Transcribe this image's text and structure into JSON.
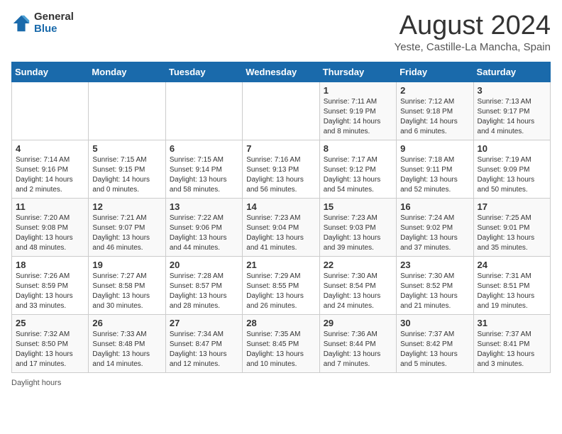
{
  "logo": {
    "general": "General",
    "blue": "Blue"
  },
  "title": "August 2024",
  "subtitle": "Yeste, Castille-La Mancha, Spain",
  "days_of_week": [
    "Sunday",
    "Monday",
    "Tuesday",
    "Wednesday",
    "Thursday",
    "Friday",
    "Saturday"
  ],
  "weeks": [
    [
      {
        "day": "",
        "info": ""
      },
      {
        "day": "",
        "info": ""
      },
      {
        "day": "",
        "info": ""
      },
      {
        "day": "",
        "info": ""
      },
      {
        "day": "1",
        "info": "Sunrise: 7:11 AM\nSunset: 9:19 PM\nDaylight: 14 hours\nand 8 minutes."
      },
      {
        "day": "2",
        "info": "Sunrise: 7:12 AM\nSunset: 9:18 PM\nDaylight: 14 hours\nand 6 minutes."
      },
      {
        "day": "3",
        "info": "Sunrise: 7:13 AM\nSunset: 9:17 PM\nDaylight: 14 hours\nand 4 minutes."
      }
    ],
    [
      {
        "day": "4",
        "info": "Sunrise: 7:14 AM\nSunset: 9:16 PM\nDaylight: 14 hours\nand 2 minutes."
      },
      {
        "day": "5",
        "info": "Sunrise: 7:15 AM\nSunset: 9:15 PM\nDaylight: 14 hours\nand 0 minutes."
      },
      {
        "day": "6",
        "info": "Sunrise: 7:15 AM\nSunset: 9:14 PM\nDaylight: 13 hours\nand 58 minutes."
      },
      {
        "day": "7",
        "info": "Sunrise: 7:16 AM\nSunset: 9:13 PM\nDaylight: 13 hours\nand 56 minutes."
      },
      {
        "day": "8",
        "info": "Sunrise: 7:17 AM\nSunset: 9:12 PM\nDaylight: 13 hours\nand 54 minutes."
      },
      {
        "day": "9",
        "info": "Sunrise: 7:18 AM\nSunset: 9:11 PM\nDaylight: 13 hours\nand 52 minutes."
      },
      {
        "day": "10",
        "info": "Sunrise: 7:19 AM\nSunset: 9:09 PM\nDaylight: 13 hours\nand 50 minutes."
      }
    ],
    [
      {
        "day": "11",
        "info": "Sunrise: 7:20 AM\nSunset: 9:08 PM\nDaylight: 13 hours\nand 48 minutes."
      },
      {
        "day": "12",
        "info": "Sunrise: 7:21 AM\nSunset: 9:07 PM\nDaylight: 13 hours\nand 46 minutes."
      },
      {
        "day": "13",
        "info": "Sunrise: 7:22 AM\nSunset: 9:06 PM\nDaylight: 13 hours\nand 44 minutes."
      },
      {
        "day": "14",
        "info": "Sunrise: 7:23 AM\nSunset: 9:04 PM\nDaylight: 13 hours\nand 41 minutes."
      },
      {
        "day": "15",
        "info": "Sunrise: 7:23 AM\nSunset: 9:03 PM\nDaylight: 13 hours\nand 39 minutes."
      },
      {
        "day": "16",
        "info": "Sunrise: 7:24 AM\nSunset: 9:02 PM\nDaylight: 13 hours\nand 37 minutes."
      },
      {
        "day": "17",
        "info": "Sunrise: 7:25 AM\nSunset: 9:01 PM\nDaylight: 13 hours\nand 35 minutes."
      }
    ],
    [
      {
        "day": "18",
        "info": "Sunrise: 7:26 AM\nSunset: 8:59 PM\nDaylight: 13 hours\nand 33 minutes."
      },
      {
        "day": "19",
        "info": "Sunrise: 7:27 AM\nSunset: 8:58 PM\nDaylight: 13 hours\nand 30 minutes."
      },
      {
        "day": "20",
        "info": "Sunrise: 7:28 AM\nSunset: 8:57 PM\nDaylight: 13 hours\nand 28 minutes."
      },
      {
        "day": "21",
        "info": "Sunrise: 7:29 AM\nSunset: 8:55 PM\nDaylight: 13 hours\nand 26 minutes."
      },
      {
        "day": "22",
        "info": "Sunrise: 7:30 AM\nSunset: 8:54 PM\nDaylight: 13 hours\nand 24 minutes."
      },
      {
        "day": "23",
        "info": "Sunrise: 7:30 AM\nSunset: 8:52 PM\nDaylight: 13 hours\nand 21 minutes."
      },
      {
        "day": "24",
        "info": "Sunrise: 7:31 AM\nSunset: 8:51 PM\nDaylight: 13 hours\nand 19 minutes."
      }
    ],
    [
      {
        "day": "25",
        "info": "Sunrise: 7:32 AM\nSunset: 8:50 PM\nDaylight: 13 hours\nand 17 minutes."
      },
      {
        "day": "26",
        "info": "Sunrise: 7:33 AM\nSunset: 8:48 PM\nDaylight: 13 hours\nand 14 minutes."
      },
      {
        "day": "27",
        "info": "Sunrise: 7:34 AM\nSunset: 8:47 PM\nDaylight: 13 hours\nand 12 minutes."
      },
      {
        "day": "28",
        "info": "Sunrise: 7:35 AM\nSunset: 8:45 PM\nDaylight: 13 hours\nand 10 minutes."
      },
      {
        "day": "29",
        "info": "Sunrise: 7:36 AM\nSunset: 8:44 PM\nDaylight: 13 hours\nand 7 minutes."
      },
      {
        "day": "30",
        "info": "Sunrise: 7:37 AM\nSunset: 8:42 PM\nDaylight: 13 hours\nand 5 minutes."
      },
      {
        "day": "31",
        "info": "Sunrise: 7:37 AM\nSunset: 8:41 PM\nDaylight: 13 hours\nand 3 minutes."
      }
    ]
  ],
  "footer": "Daylight hours"
}
